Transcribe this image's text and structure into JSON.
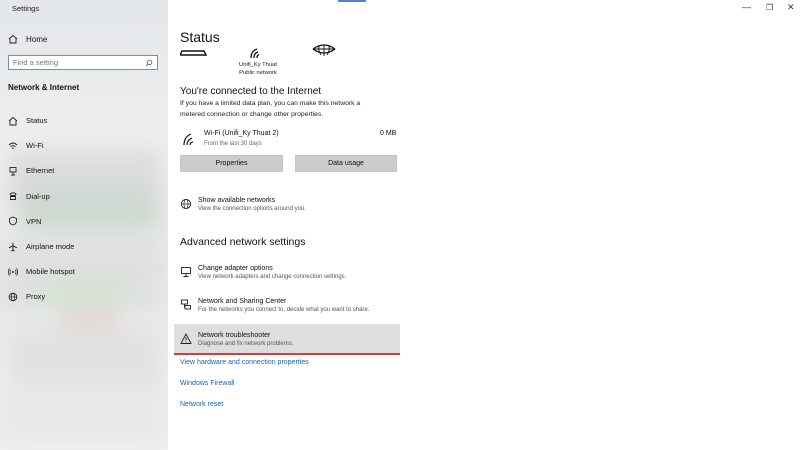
{
  "window": {
    "app_title": "Settings",
    "min": "—",
    "restore": "❐",
    "close": "✕"
  },
  "sidebar": {
    "home_label": "Home",
    "search_placeholder": "Find a setting",
    "section_title": "Network & Internet",
    "items": [
      {
        "label": "Status",
        "icon": "home-status-icon"
      },
      {
        "label": "Wi-Fi",
        "icon": "wifi-icon"
      },
      {
        "label": "Ethernet",
        "icon": "ethernet-icon"
      },
      {
        "label": "Dial-up",
        "icon": "dialup-icon"
      },
      {
        "label": "VPN",
        "icon": "vpn-icon"
      },
      {
        "label": "Airplane mode",
        "icon": "airplane-icon"
      },
      {
        "label": "Mobile hotspot",
        "icon": "hotspot-icon"
      },
      {
        "label": "Proxy",
        "icon": "globe-icon"
      }
    ]
  },
  "main": {
    "title": "Status",
    "network_name": "Unifi_Ky Thuat",
    "network_type": "Public network",
    "connected_heading": "You're connected to the Internet",
    "connected_desc_1": "If you have a limited data plan, you can make this network a",
    "connected_desc_2": "metered connection or change other properties.",
    "connection": {
      "name": "Wi-Fi (Unifi_Ky Thuat 2)",
      "sub": "From the last 30 days",
      "usage": "0 MB"
    },
    "buttons": {
      "properties": "Properties",
      "data_usage": "Data usage"
    },
    "show_networks": {
      "title": "Show available networks",
      "sub": "View the connection options around you."
    },
    "advanced_heading": "Advanced network settings",
    "advanced": [
      {
        "title": "Change adapter options",
        "sub": "View network adapters and change connection settings."
      },
      {
        "title": "Network and Sharing Center",
        "sub": "For the networks you connect to, decide what you want to share."
      },
      {
        "title": "Network troubleshooter",
        "sub": "Diagnose and fix network problems."
      }
    ],
    "links": [
      "View hardware and connection properties",
      "Windows Firewall",
      "Network reset"
    ]
  },
  "colors": {
    "accent": "#1a63b8",
    "highlight_line": "#d93a3a"
  }
}
